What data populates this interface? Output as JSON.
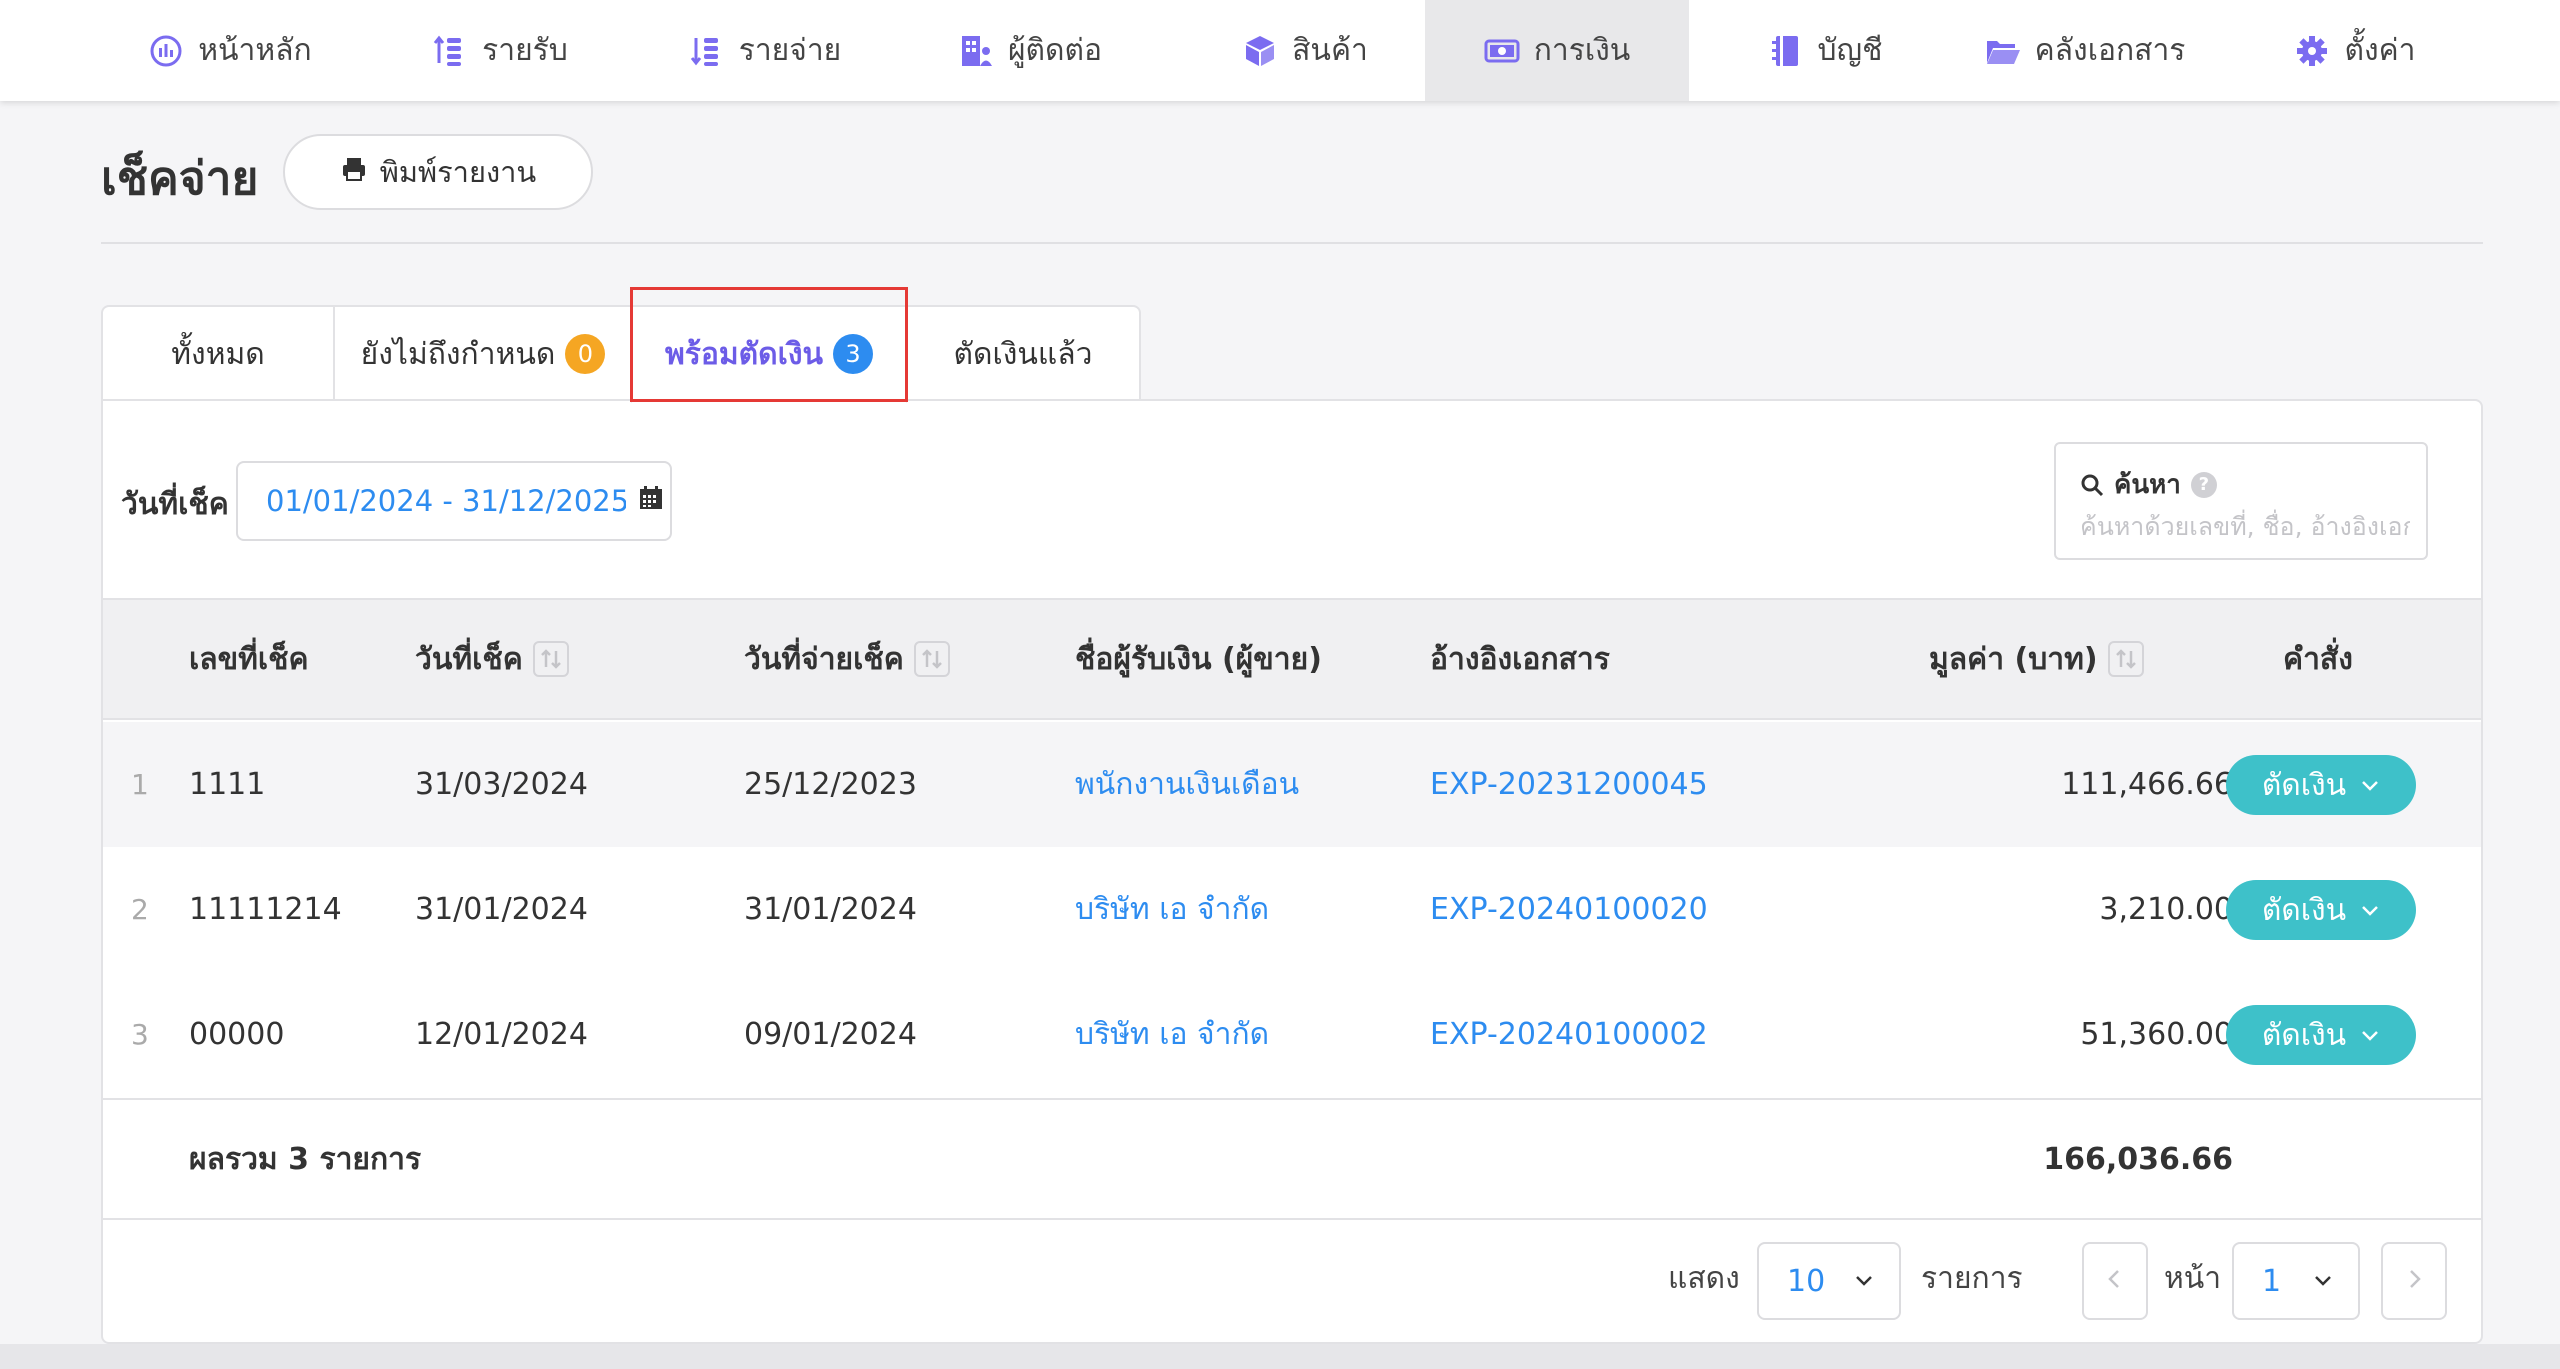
{
  "nav": {
    "items": [
      {
        "label": "หน้าหลัก",
        "icon": "dashboard-icon"
      },
      {
        "label": "รายรับ",
        "icon": "income-icon"
      },
      {
        "label": "รายจ่าย",
        "icon": "expense-icon"
      },
      {
        "label": "ผู้ติดต่อ",
        "icon": "contacts-building-icon"
      },
      {
        "label": "สินค้า",
        "icon": "product-box-icon"
      },
      {
        "label": "การเงิน",
        "icon": "money-icon"
      },
      {
        "label": "บัญชี",
        "icon": "ledger-book-icon"
      },
      {
        "label": "คลังเอกสาร",
        "icon": "folder-open-icon"
      },
      {
        "label": "ตั้งค่า",
        "icon": "gear-icon"
      }
    ],
    "active_index": 5
  },
  "page": {
    "title": "เช็คจ่าย",
    "print_label": "พิมพ์รายงาน"
  },
  "tabs": [
    {
      "label": "ทั้งหมด"
    },
    {
      "label": "ยังไม่ถึงกำหนด",
      "badge": "0"
    },
    {
      "label": "พร้อมตัดเงิน",
      "badge": "3"
    },
    {
      "label": "ตัดเงินแล้ว"
    }
  ],
  "colors": {
    "accent": "#6c5ce7",
    "link": "#2d8cf0",
    "action": "#3ec1c9",
    "badge_orange": "#f5a623",
    "badge_blue": "#2d8cf0",
    "highlight": "#e53935"
  },
  "filter": {
    "date_label": "วันที่เช็ค",
    "date_range": "01/01/2024 - 31/12/2025"
  },
  "search": {
    "label": "ค้นหา",
    "help": "?",
    "placeholder": "ค้นหาด้วยเลขที่, ชื่อ, อ้างอิงเอกสาร"
  },
  "table": {
    "columns": {
      "number": "เลขที่เช็ค",
      "check_date": "วันที่เช็ค",
      "pay_date": "วันที่จ่ายเช็ค",
      "payee": "ชื่อผู้รับเงิน (ผู้ขาย)",
      "reference": "อ้างอิงเอกสาร",
      "amount": "มูลค่า (บาท)",
      "action": "คำสั่ง"
    },
    "rows": [
      {
        "idx": "1",
        "number": "1111",
        "check_date": "31/03/2024",
        "pay_date": "25/12/2023",
        "payee": "พนักงานเงินเดือน",
        "reference": "EXP-20231200045",
        "amount": "111,466.66",
        "action": "ตัดเงิน"
      },
      {
        "idx": "2",
        "number": "11111214",
        "check_date": "31/01/2024",
        "pay_date": "31/01/2024",
        "payee": "บริษัท เอ จำกัด",
        "reference": "EXP-20240100020",
        "amount": "3,210.00",
        "action": "ตัดเงิน"
      },
      {
        "idx": "3",
        "number": "00000",
        "check_date": "12/01/2024",
        "pay_date": "09/01/2024",
        "payee": "บริษัท เอ จำกัด",
        "reference": "EXP-20240100002",
        "amount": "51,360.00",
        "action": "ตัดเงิน"
      }
    ],
    "total_label": "ผลรวม 3 รายการ",
    "total_value": "166,036.66"
  },
  "pagination": {
    "show_label": "แสดง",
    "page_size": "10",
    "items_label": "รายการ",
    "page_label": "หน้า",
    "page": "1"
  }
}
